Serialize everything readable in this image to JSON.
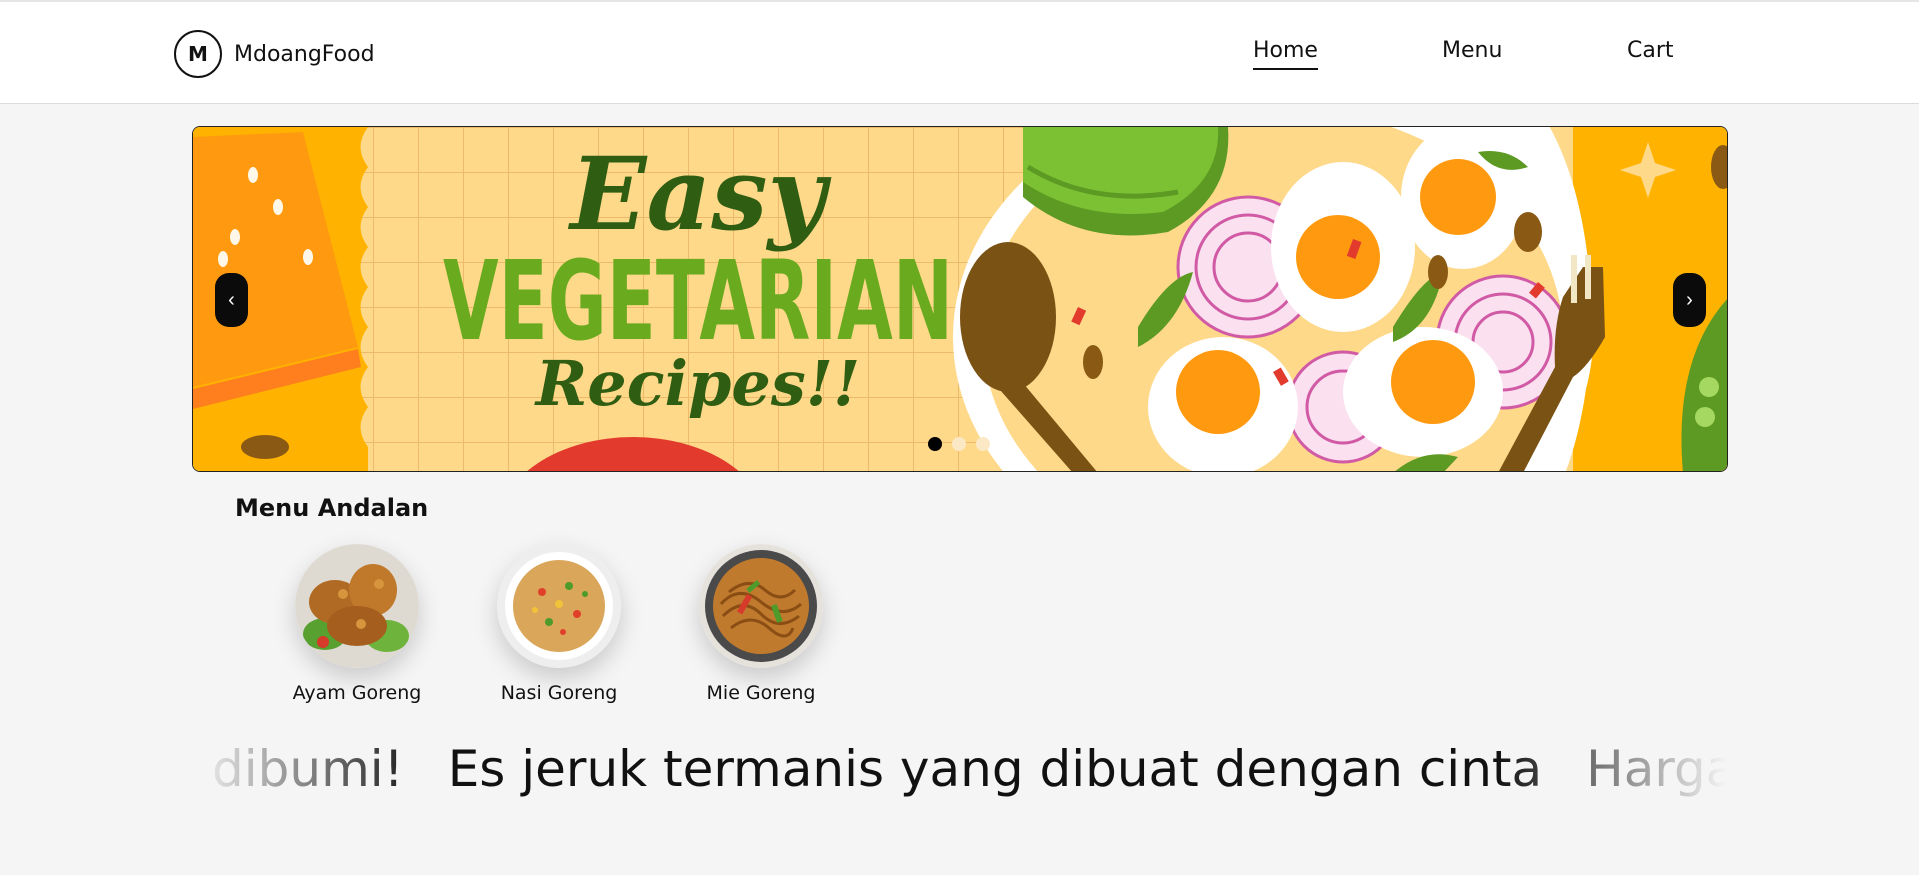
{
  "header": {
    "logo_letter": "M",
    "brand": "MdoangFood",
    "nav": [
      {
        "label": "Home",
        "active": true
      },
      {
        "label": "Menu",
        "active": false
      },
      {
        "label": "Cart",
        "active": false
      }
    ]
  },
  "banner": {
    "line1": "Easy",
    "line2": "VEGETARIAN",
    "line3": "Recipes!!",
    "prev_icon": "chevron-left-icon",
    "next_icon": "chevron-right-icon",
    "prev_glyph": "‹",
    "next_glyph": "›",
    "slide_count": 3,
    "active_slide": 1
  },
  "featured": {
    "title": "Menu Andalan",
    "items": [
      {
        "name": "Ayam Goreng",
        "image": "fried-chicken"
      },
      {
        "name": "Nasi Goreng",
        "image": "fried-rice"
      },
      {
        "name": "Mie Goreng",
        "image": "fried-noodles"
      }
    ]
  },
  "marquee": {
    "items": [
      "Es campur terenak dibumi!",
      "Es jeruk termanis yang dibuat dengan cinta",
      "Harga terjangkau"
    ]
  },
  "colors": {
    "banner_bg": "#ffd98a",
    "green_dark": "#2f5d12",
    "green_bright": "#6aaa1e",
    "orange": "#ff9a10",
    "page_bg": "#f5f5f5"
  }
}
